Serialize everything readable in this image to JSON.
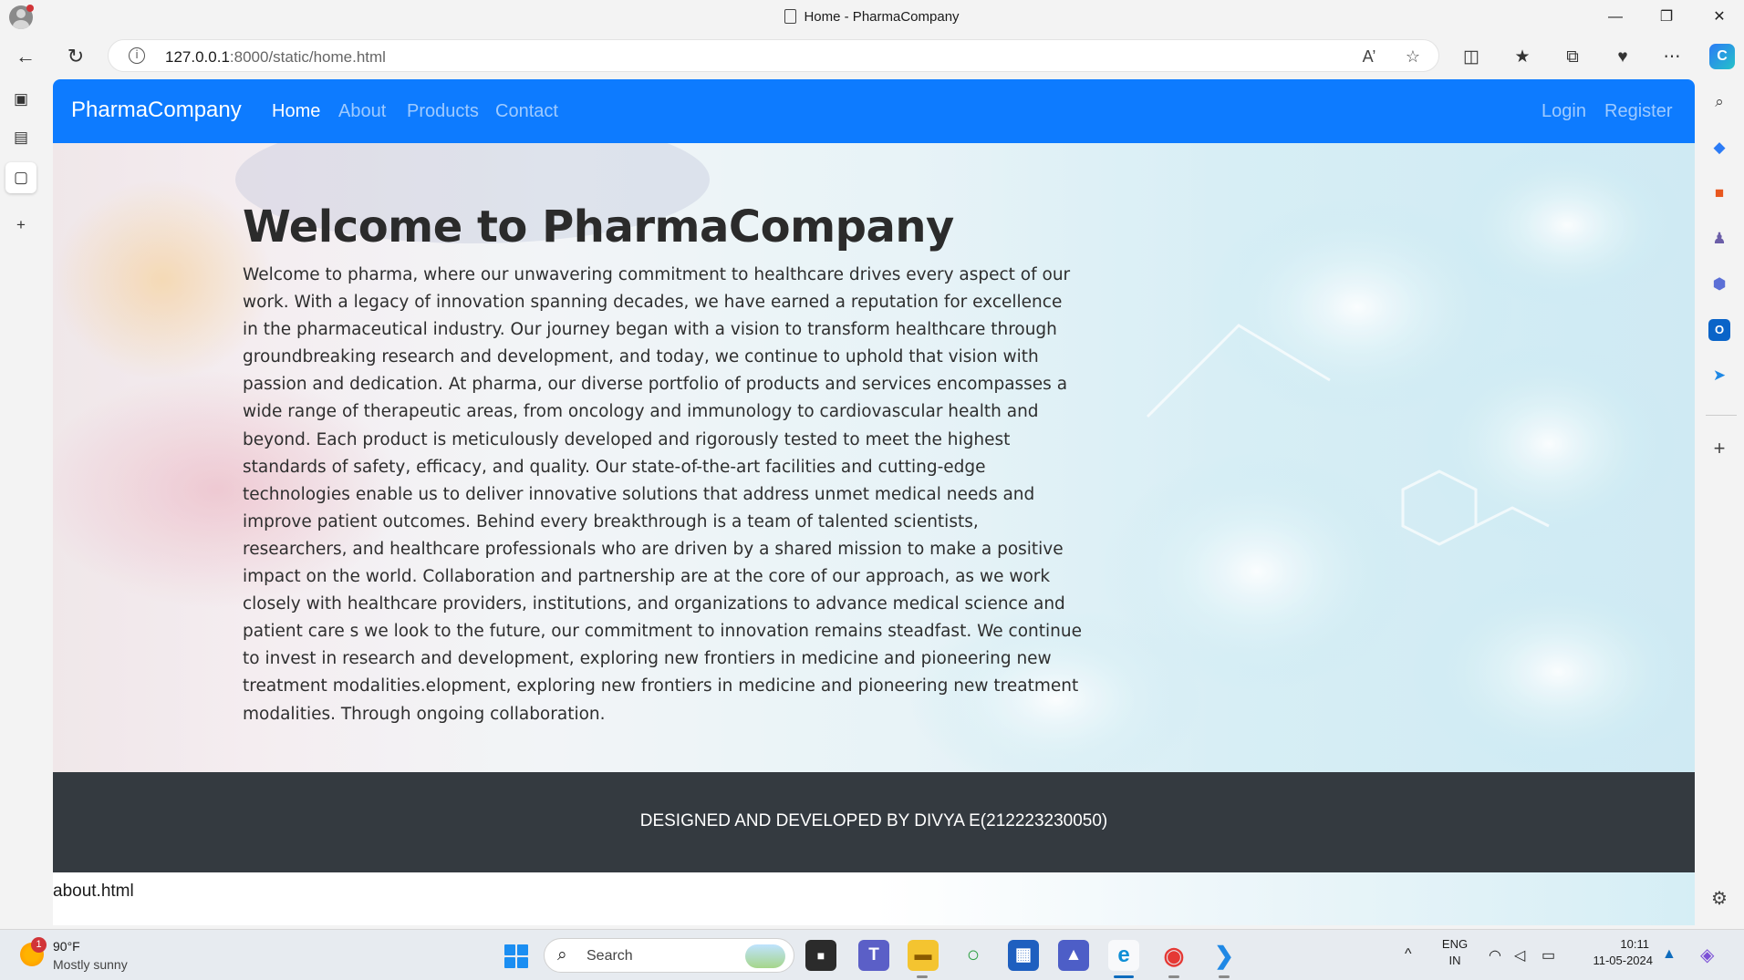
{
  "window": {
    "title": "Home - PharmaCompany",
    "minimize": "—",
    "restore": "❐",
    "close": "✕"
  },
  "browser": {
    "back": "←",
    "reload": "↻",
    "url_host": "127.0.0.1",
    "url_rest": ":8000/static/home.html",
    "read_aloud": "A’",
    "favorite": "☆",
    "split": "◫",
    "favorites": "★",
    "collections": "⧉",
    "extensions": "♥",
    "more": "⋯",
    "copilot": "C"
  },
  "left_tabs": {
    "sidebar": "▣",
    "workspaces": "▤",
    "page": "▢",
    "new_tab": "+"
  },
  "right_sidebar": {
    "search": "⌕",
    "shopping": "◆",
    "tools": "■",
    "games": "♟",
    "office": "⬢",
    "outlook": "O",
    "telegram": "➤",
    "add": "+",
    "settings": "⚙"
  },
  "site": {
    "brand": "PharmaCompany",
    "nav": {
      "home": "Home",
      "about": "About",
      "products": "Products",
      "contact": "Contact",
      "login": "Login",
      "register": "Register"
    },
    "hero": {
      "heading": "Welcome to PharmaCompany",
      "body": "Welcome to pharma, where our unwavering commitment to healthcare drives every aspect of our work. With a legacy of innovation spanning decades, we have earned a reputation for excellence in the pharmaceutical industry. Our journey began with a vision to transform healthcare through groundbreaking research and development, and today, we continue to uphold that vision with passion and dedication. At pharma, our diverse portfolio of products and services encompasses a wide range of therapeutic areas, from oncology and immunology to cardiovascular health and beyond. Each product is meticulously developed and rigorously tested to meet the highest standards of safety, efficacy, and quality. Our state-of-the-art facilities and cutting-edge technologies enable us to deliver innovative solutions that address unmet medical needs and improve patient outcomes. Behind every breakthrough is a team of talented scientists, researchers, and healthcare professionals who are driven by a shared mission to make a positive impact on the world. Collaboration and partnership are at the core of our approach, as we work closely with healthcare providers, institutions, and organizations to advance medical science and patient care s we look to the future, our commitment to innovation remains steadfast. We continue to invest in research and development, exploring new frontiers in medicine and pioneering new treatment modalities.elopment, exploring new frontiers in medicine and pioneering new treatment modalities. Through ongoing collaboration."
    },
    "footer": "DESIGNED AND DEVELOPED BY DIVYA E(212223230050)",
    "below_link": "about.html"
  },
  "taskbar": {
    "weather_badge": "1",
    "weather_temp": "90°F",
    "weather_desc": "Mostly sunny",
    "search_label": "Search",
    "search_glyph": "⌕",
    "apps": {
      "terminal": "■",
      "teams": "T",
      "explorer": "▬",
      "circle_app": "○",
      "store": "▦",
      "vectorworks": "▲",
      "edge": "e",
      "chrome": "◉",
      "vscode": "❯"
    },
    "tray_chevron": "^",
    "lang_top": "ENG",
    "lang_bottom": "IN",
    "wifi": "◠",
    "volume": "◁",
    "battery": "▭",
    "time": "10:11",
    "date": "11-05-2024",
    "bell": "▲",
    "copilot": "◈"
  },
  "colors": {
    "navbar": "#0d7bff",
    "footer": "#343a40",
    "taskbar": "#e7ebf0"
  }
}
